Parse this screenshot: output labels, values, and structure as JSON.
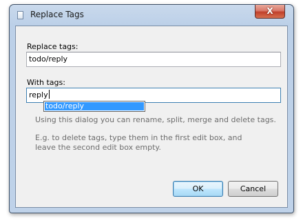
{
  "window": {
    "title": "Replace Tags",
    "close_glyph": "X"
  },
  "form": {
    "replace_label": "Replace tags:",
    "replace_value": "todo/reply",
    "with_label": "With tags:",
    "with_value": "reply"
  },
  "autocomplete": {
    "items": [
      "todo/reply"
    ],
    "selected_index": 0
  },
  "help": {
    "line1": "Using this dialog you can rename, split, merge and delete tags.",
    "line2": "E.g. to delete tags, type them in the first edit box, and leave the second edit box empty."
  },
  "buttons": {
    "ok": "OK",
    "cancel": "Cancel"
  },
  "colors": {
    "selection": "#3399ff",
    "close_button": "#c0402b",
    "window_frame": "#bfd2e9"
  },
  "icons": {
    "app": "dialog-app-icon",
    "close": "close-icon"
  }
}
